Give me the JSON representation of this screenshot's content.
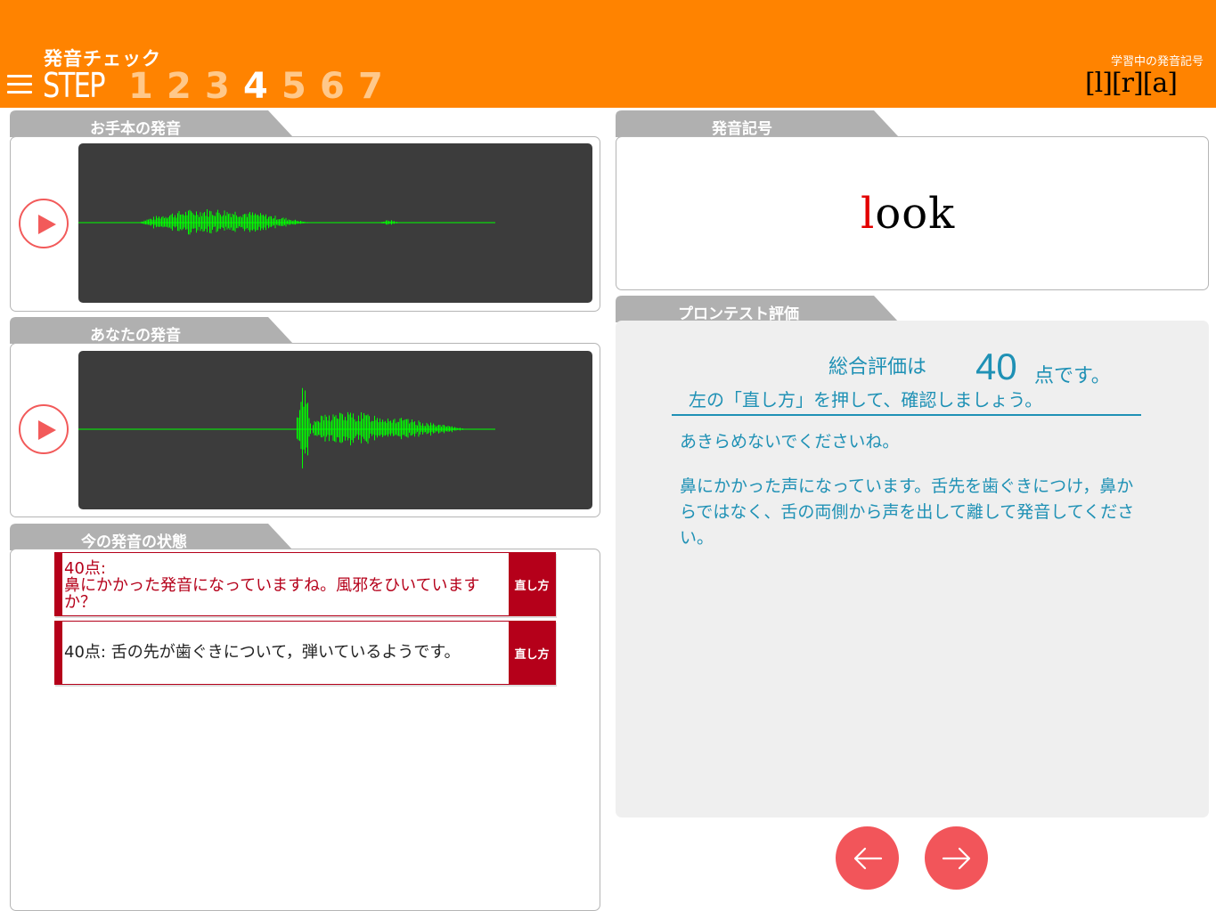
{
  "header": {
    "title": "発音チェック",
    "step_label": "STEP",
    "steps": [
      "1",
      "2",
      "3",
      "4",
      "5",
      "6",
      "7"
    ],
    "active_step": "4",
    "symbols_label": "学習中の発音記号",
    "symbols_value": "[l][r][a]"
  },
  "sections": {
    "model": "お手本の発音",
    "yours": "あなたの発音",
    "status": "今の発音の状態",
    "symbol": "発音記号",
    "evaluation": "プロンテスト評価"
  },
  "word": {
    "highlight": "l",
    "rest": "ook"
  },
  "feedback": [
    {
      "text": "40点:\n鼻にかかった発音になっていますね。風邪をひいています\nか？",
      "fix_label": "直し方"
    },
    {
      "text": "40点: 舌の先が歯ぐきについて，弾いているようです。",
      "fix_label": "直し方"
    }
  ],
  "evaluation": {
    "score_prefix": "総合評価は",
    "score": "40",
    "score_suffix": "点です。",
    "instruction": "左の「直し方」を押して、確認しましょう。",
    "encourage": "あきらめないでくださいね。",
    "advice": "鼻にかかった声になっています。舌先を歯ぐきにつけ，鼻からではなく、舌の両側から声を出して離して発音してください。"
  },
  "colors": {
    "header": "#ff8300",
    "waveform": "#00ff00",
    "accent_red": "#b5001a",
    "text_blue": "#1f91b5",
    "nav_button": "#f2555a"
  },
  "icons": {
    "menu": "hamburger-icon",
    "play": "play-icon",
    "prev": "arrow-left-icon",
    "next": "arrow-right-icon"
  }
}
